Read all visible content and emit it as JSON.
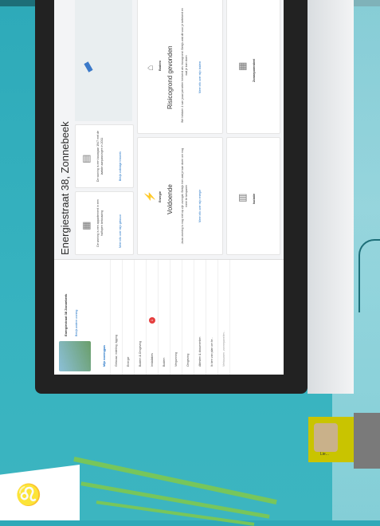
{
  "app": {
    "title": "Energiestraat 38, Zonnebeek"
  },
  "sidebar": {
    "address_line": "Energiestraat 38 Zonnebeek",
    "address_link": "Bekijk andere woning",
    "items": [
      {
        "label": "Mijn woningpas",
        "active": true
      },
      {
        "label": "Gebouw, indeling, ligging"
      },
      {
        "label": "Energie"
      },
      {
        "label": "Bodem & Omgeving"
      },
      {
        "label": "Installaties",
        "badge": "1"
      },
      {
        "label": "Bodem"
      },
      {
        "label": "Vergunning"
      },
      {
        "label": "Omgeving"
      },
      {
        "label": "Attesten & documenten"
      },
      {
        "label": "Ik ben van plan om te..."
      }
    ],
    "search_placeholder": "Verbouwen, zonnepanelen..."
  },
  "cards": {
    "c1_text": "De woning is een appartement in een halfopen bebouwing",
    "c1_link": "Meer info over mijn gebouw",
    "c2_text": "De woning is een bouwjaar 1947 met de laatste aanpassingen in 2011",
    "c2_link": "Bekijk volledige historiek",
    "energie_label": "Energie",
    "energie_title": "Voldoende",
    "energie_text": "Jouw woning is nog niet op zijn zuinigst. Bekijk hier wat je kan doen om nog meer te besparen",
    "energie_link": "Meer info over mijn energie",
    "bodem_label": "Bodem",
    "bodem_title": "Risicogrond gevonden",
    "bodem_text": "We hebben 1 van jouw percelen herkend als risicogrond. Bekijk wat dit voor je betekent en wat je kan doen",
    "bodem_link": "Meer info over mijn bodem",
    "isolatie_label": "Isolatie",
    "zonne_label": "Zonnepotentieel"
  },
  "photo_card": {
    "label": "Lie..."
  },
  "colors": {
    "background": "#2fa9b8",
    "link": "#1a6fc4",
    "badge": "#e53e3e"
  }
}
